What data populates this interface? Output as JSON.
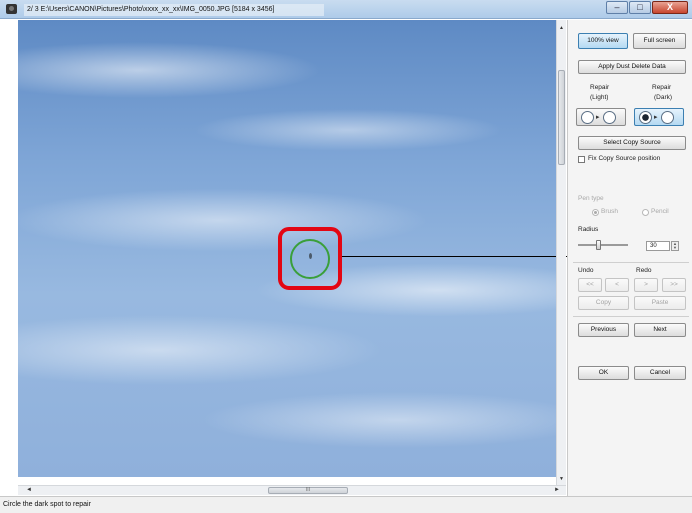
{
  "window": {
    "title": "2/ 3  E:\\Users\\CANON\\Pictures\\Photo\\xxxx_xx_xx\\IMG_0050.JPG [5184 x 3456]",
    "minimize": "–",
    "maximize": "□",
    "close": "X"
  },
  "status": {
    "text": "Circle the dark spot to repair"
  },
  "scroll": {
    "up": "▲",
    "down": "▼",
    "left": "◄",
    "right": "►",
    "grip": "III"
  },
  "panel": {
    "view_100": "100% view",
    "full_screen": "Full screen",
    "apply_dust": "Apply Dust Delete Data",
    "repair_light_line1": "Repair",
    "repair_light_line2": "(Light)",
    "repair_dark_line1": "Repair",
    "repair_dark_line2": "(Dark)",
    "select_copy_source": "Select Copy Source",
    "fix_copy_source": "Fix Copy Source position",
    "pen_type": "Pen type",
    "brush": "Brush",
    "pencil": "Pencil",
    "radius": "Radius",
    "radius_value": "30",
    "undo": "Undo",
    "redo": "Redo",
    "undo_all": "<<",
    "undo_one": "<",
    "redo_one": ">",
    "redo_all": ">>",
    "copy": "Copy",
    "paste": "Paste",
    "previous": "Previous",
    "next": "Next",
    "ok": "OK",
    "cancel": "Cancel"
  },
  "colors": {
    "highlight": "#e30613",
    "spot_ring": "#3a9f3a"
  }
}
